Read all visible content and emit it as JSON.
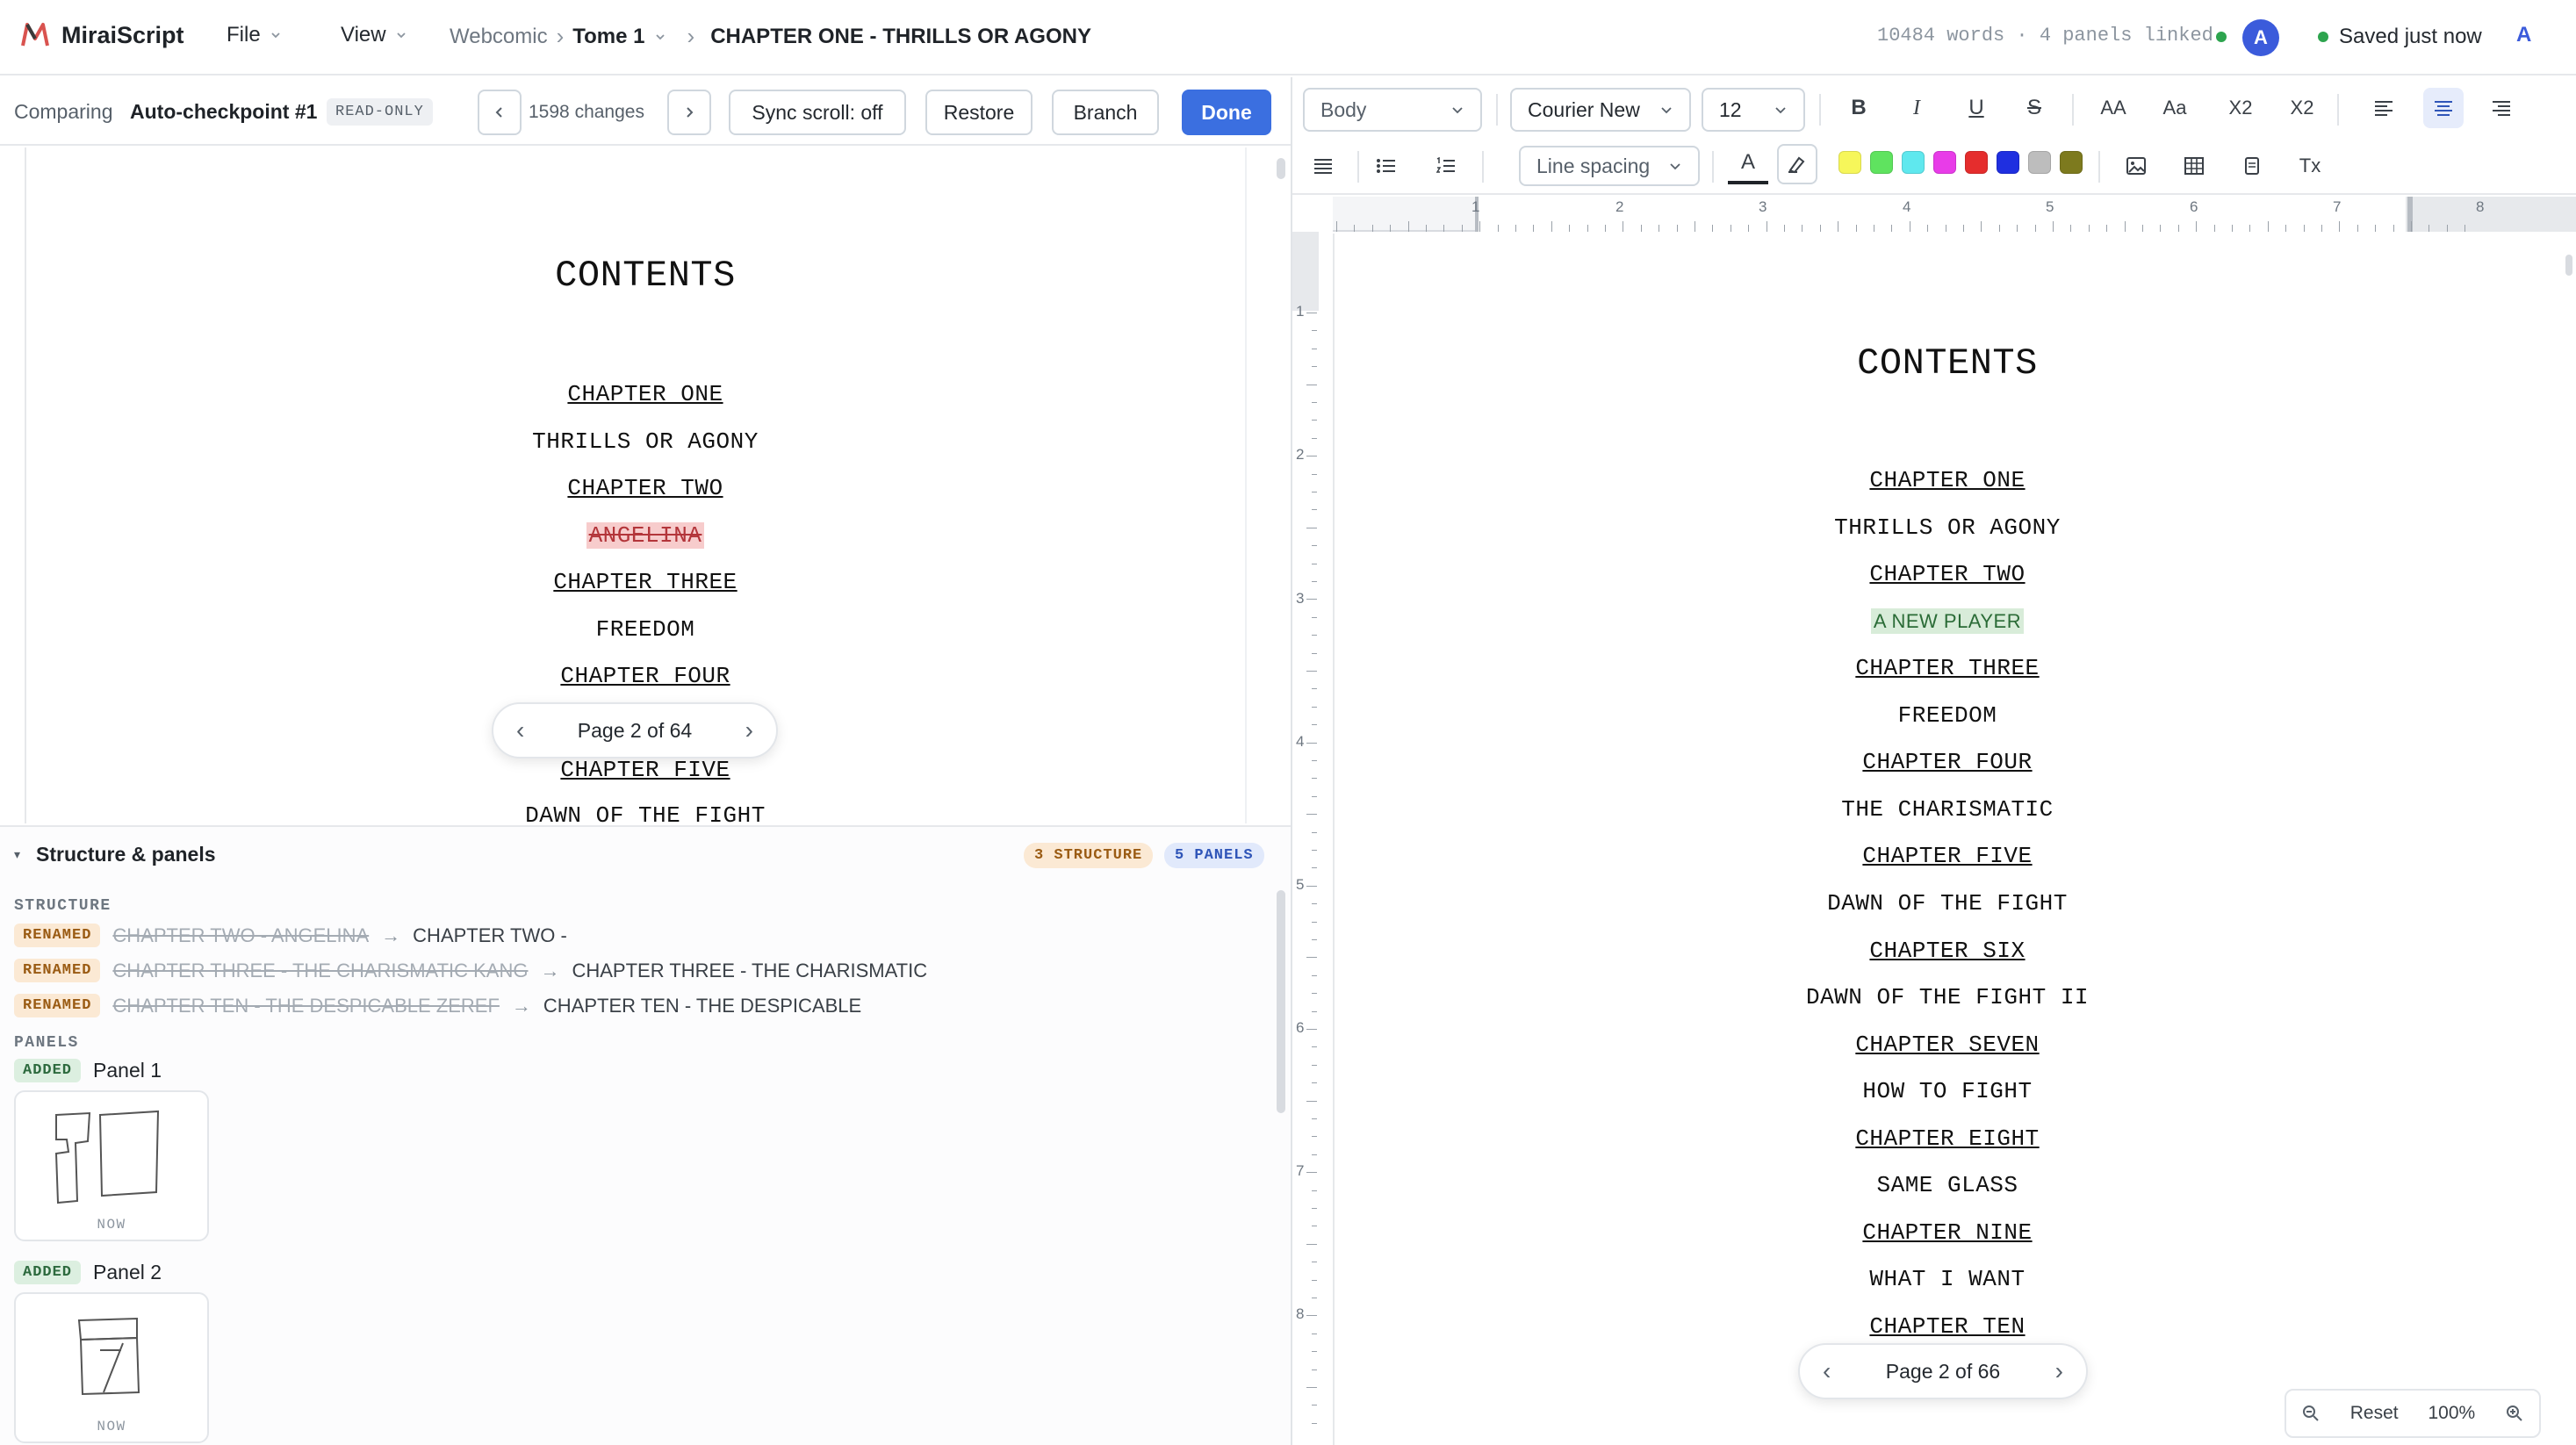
{
  "app": {
    "name": "MiraiScript"
  },
  "menu": {
    "file": "File",
    "view": "View"
  },
  "breadcrumb": {
    "project": "Webcomic",
    "volume": "Tome 1",
    "chapter": "CHAPTER ONE - THRILLS OR AGONY"
  },
  "status": {
    "meta": "10484 words · 4 panels linked",
    "avatar": "A",
    "saved": "Saved just now",
    "user": "A"
  },
  "compare": {
    "label": "Comparing",
    "checkpoint": "Auto-checkpoint #1",
    "readonly": "READ-ONLY",
    "changes_count": "1598",
    "changes_label": "changes",
    "sync": "Sync scroll: off",
    "restore": "Restore",
    "branch": "Branch",
    "done": "Done"
  },
  "left_doc": {
    "heading": "CONTENTS",
    "lines": [
      "CHAPTER ONE",
      "THRILLS OR AGONY",
      "CHAPTER TWO",
      "ANGELINA",
      "CHAPTER THREE",
      "FREEDOM",
      "CHAPTER FOUR",
      "CHAPTER FIVE",
      "DAWN OF THE FIGHT"
    ],
    "pager": "Page 2 of 64"
  },
  "structure_panel": {
    "title": "Structure & panels",
    "structure_badge": "3 STRUCTURE",
    "panels_badge": "5 PANELS",
    "structure_label": "STRUCTURE",
    "renames": [
      {
        "tag": "RENAMED",
        "old": "CHAPTER TWO - ANGELINA",
        "new": "CHAPTER TWO -"
      },
      {
        "tag": "RENAMED",
        "old": "CHAPTER THREE - THE CHARISMATIC KANG",
        "new": "CHAPTER THREE - THE CHARISMATIC"
      },
      {
        "tag": "RENAMED",
        "old": "CHAPTER TEN - THE DESPICABLE ZEREF",
        "new": "CHAPTER TEN - THE DESPICABLE"
      }
    ],
    "panels_label": "PANELS",
    "panels": [
      {
        "tag": "ADDED",
        "name": "Panel 1",
        "time": "NOW"
      },
      {
        "tag": "ADDED",
        "name": "Panel 2",
        "time": "NOW"
      }
    ]
  },
  "toolbar": {
    "style": "Body",
    "font": "Courier New",
    "size": "12",
    "bold": "B",
    "italic": "I",
    "underline": "U",
    "strike": "S",
    "upper": "AA",
    "title_case": "Aa",
    "sub": "X2",
    "sup": "X2",
    "line_spacing": "Line spacing",
    "text_color": "A",
    "clear": "Tx",
    "swatches": [
      "#f6f65a",
      "#5fe35f",
      "#5fe8ee",
      "#e83ce8",
      "#e52d2d",
      "#1f2fe0",
      "#bdbdbd",
      "#7d7a1e"
    ]
  },
  "ruler": {
    "h": [
      "1",
      "2",
      "3",
      "4",
      "5",
      "6",
      "7",
      "8"
    ],
    "v": [
      "1",
      "2",
      "3",
      "4",
      "5",
      "6",
      "7",
      "8"
    ]
  },
  "right_doc": {
    "heading": "CONTENTS",
    "lines": [
      "CHAPTER ONE",
      "THRILLS OR AGONY",
      "CHAPTER TWO",
      "A NEW PLAYER",
      "CHAPTER THREE",
      "FREEDOM",
      "CHAPTER FOUR",
      "THE CHARISMATIC",
      "CHAPTER FIVE",
      "DAWN OF THE FIGHT",
      "CHAPTER SIX",
      "DAWN OF THE FIGHT II",
      "CHAPTER SEVEN",
      "HOW TO FIGHT",
      "CHAPTER EIGHT",
      "SAME GLASS",
      "CHAPTER NINE",
      "WHAT I WANT",
      "CHAPTER TEN"
    ],
    "pager": "Page 2 of 66"
  },
  "zoom": {
    "reset": "Reset",
    "level": "100%"
  }
}
